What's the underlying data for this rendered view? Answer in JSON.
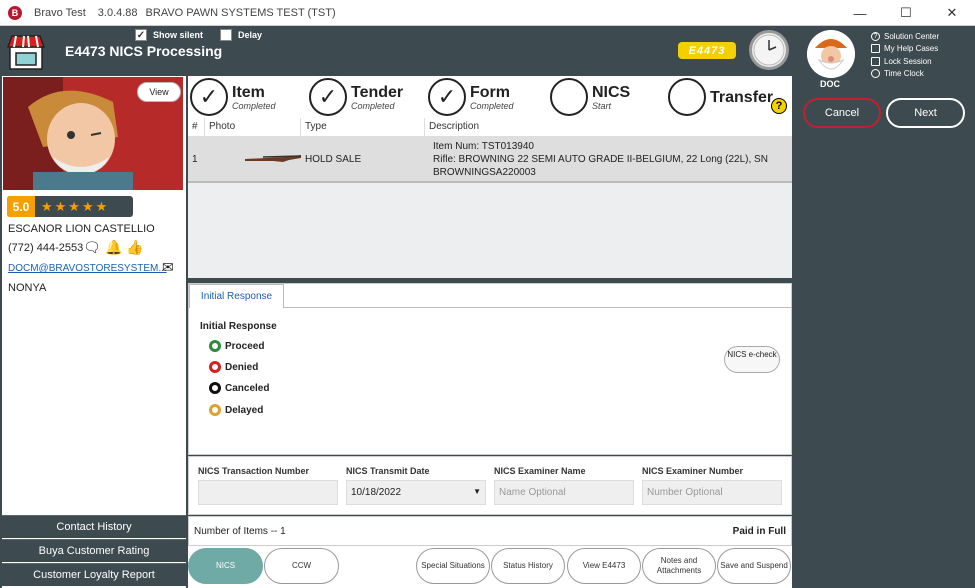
{
  "titlebar": {
    "app_name": "Bravo Test",
    "version": "3.0.4.88",
    "system": "BRAVO PAWN SYSTEMS TEST (TST)",
    "logo_letter": "B",
    "minimize": "—",
    "maximize": "☐",
    "close": "✕"
  },
  "header": {
    "title": "E4473 NICS Processing",
    "show_silent": "Show silent",
    "delay": "Delay",
    "badge": "E4473",
    "checkmark": "✓"
  },
  "user": {
    "name": "DOC",
    "links": [
      "Solution Center",
      "My Help Cases",
      "Lock Session",
      "Time Clock"
    ]
  },
  "actions": {
    "cancel": "Cancel",
    "next": "Next"
  },
  "customer": {
    "view": "View",
    "rating": "5.0",
    "stars": "★★★★★",
    "name": "ESCANOR LION CASTELLIO",
    "phone": "(772) 444-2553",
    "email": "DOCM@BRAVOSTORESYSTEM...",
    "note": "NONYA"
  },
  "left_footer": [
    "Contact History",
    "Buya Customer Rating",
    "Customer Loyalty Report"
  ],
  "steps": [
    {
      "name": "Item",
      "status": "Completed",
      "done": true
    },
    {
      "name": "Tender",
      "status": "Completed",
      "done": true
    },
    {
      "name": "Form",
      "status": "Completed",
      "done": true
    },
    {
      "name": "NICS",
      "status": "Start",
      "done": false
    },
    {
      "name": "Transfer",
      "status": "",
      "done": false
    }
  ],
  "help": "?",
  "grid": {
    "headers": [
      "#",
      "Photo",
      "Type",
      "Description"
    ],
    "rows": [
      {
        "num": "1",
        "type": "HOLD SALE",
        "description_line1": "Item Num: TST013940",
        "description_line2": "Rifle: BROWNING 22 SEMI AUTO GRADE II-BELGIUM, 22 Long (22L), SN",
        "description_line3": "BROWNINGSA220003"
      }
    ]
  },
  "response": {
    "tab": "Initial Response",
    "title": "Initial Response",
    "options": [
      {
        "label": "Proceed",
        "color": "#2e8b3e"
      },
      {
        "label": "Denied",
        "color": "#d62020"
      },
      {
        "label": "Canceled",
        "color": "#111111"
      },
      {
        "label": "Delayed",
        "color": "#e0a030"
      }
    ],
    "echeck": "NICS e-check"
  },
  "fields": {
    "transaction_number": {
      "label": "NICS Transaction Number",
      "value": ""
    },
    "transmit_date": {
      "label": "NICS Transmit Date",
      "value": "10/18/2022",
      "arrow": "▼"
    },
    "examiner_name": {
      "label": "NICS Examiner Name",
      "placeholder": "Name Optional"
    },
    "examiner_number": {
      "label": "NICS Examiner Number",
      "placeholder": "Number Optional"
    }
  },
  "summary": {
    "items": "Number of Items -- 1",
    "status": "Paid in Full"
  },
  "bottom_buttons": [
    {
      "label": "NICS",
      "active": true
    },
    {
      "label": "CCW",
      "active": false
    },
    {
      "label": "Special Situations",
      "active": false
    },
    {
      "label": "Status History",
      "active": false
    },
    {
      "label": "View E4473",
      "active": false
    },
    {
      "label": "Notes and Attachments",
      "active": false
    },
    {
      "label": "Save and Suspend",
      "active": false
    }
  ]
}
